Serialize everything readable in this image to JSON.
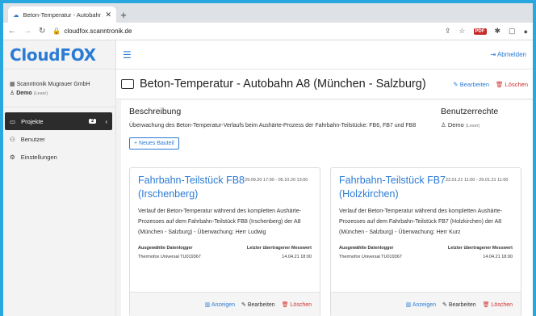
{
  "browser": {
    "tab_title": "Beton-Temperatur - Autobahn A",
    "url": "cloudfox.scanntronik.de"
  },
  "sidebar": {
    "logo": "CloudFOX",
    "org_name": "Scanntronik Mugrauer GmbH",
    "user_name": "Demo",
    "user_role": "(Leser)",
    "items": [
      {
        "label": "Projekte",
        "badge": "2"
      },
      {
        "label": "Benutzer"
      },
      {
        "label": "Einstellungen"
      }
    ]
  },
  "topbar": {
    "logout_label": "Abmelden"
  },
  "page": {
    "title": "Beton-Temperatur - Autobahn A8 (München - Salzburg)",
    "edit_label": "Bearbeiten",
    "delete_label": "Löschen"
  },
  "description": {
    "heading": "Beschreibung",
    "text": "Überwachung des Beton-Temperatur-Verlaufs beim Aushärte-Prozess der Fahrbahn-Teilstücke: FB6, FB7 und FB8",
    "new_button": "Neues Bauteil"
  },
  "rights": {
    "heading": "Benutzerrechte",
    "user": "Demo",
    "role": "(Leser)"
  },
  "cards": [
    {
      "title": "Fahrbahn-Teilstück FB8",
      "dates": "29.09.20 17:00 - 05.10.20 13:00",
      "subtitle": "(Irschenberg)",
      "text": "Verlauf der Beton-Temperatur während des kompletten Aushärte-Prozesses auf dem Fahrbahn-Teilstück FB8 (Irschenberg) der A8 (München - Salzburg) - Überwachung: Herr Ludwig",
      "col1_header": "Ausgewählte Datenlogger",
      "col2_header": "Letzter übertragener Messwert",
      "logger": "Thermofox Universal TU019367",
      "last_value": "14.04.21 18:00",
      "show_label": "Anzeigen",
      "edit_label": "Bearbeiten",
      "delete_label": "Löschen"
    },
    {
      "title": "Fahrbahn-Teilstück FB7",
      "dates": "22.01.21 11:00 - 29.01.21 11:00",
      "subtitle": "(Holzkirchen)",
      "text": "Verlauf der Beton-Temperatur während des kompletten Aushärte-Prozesses auf dem Fahrbahn-Teilstück FB7 (Holzkirchen) der A8 (München - Salzburg) - Überwachung: Herr Kurz",
      "col1_header": "Ausgewählte Datenlogger",
      "col2_header": "Letzter übertragener Messwert",
      "logger": "Thermofox Universal TU019367",
      "last_value": "14.04.21 18:00",
      "show_label": "Anzeigen",
      "edit_label": "Bearbeiten",
      "delete_label": "Löschen"
    }
  ]
}
